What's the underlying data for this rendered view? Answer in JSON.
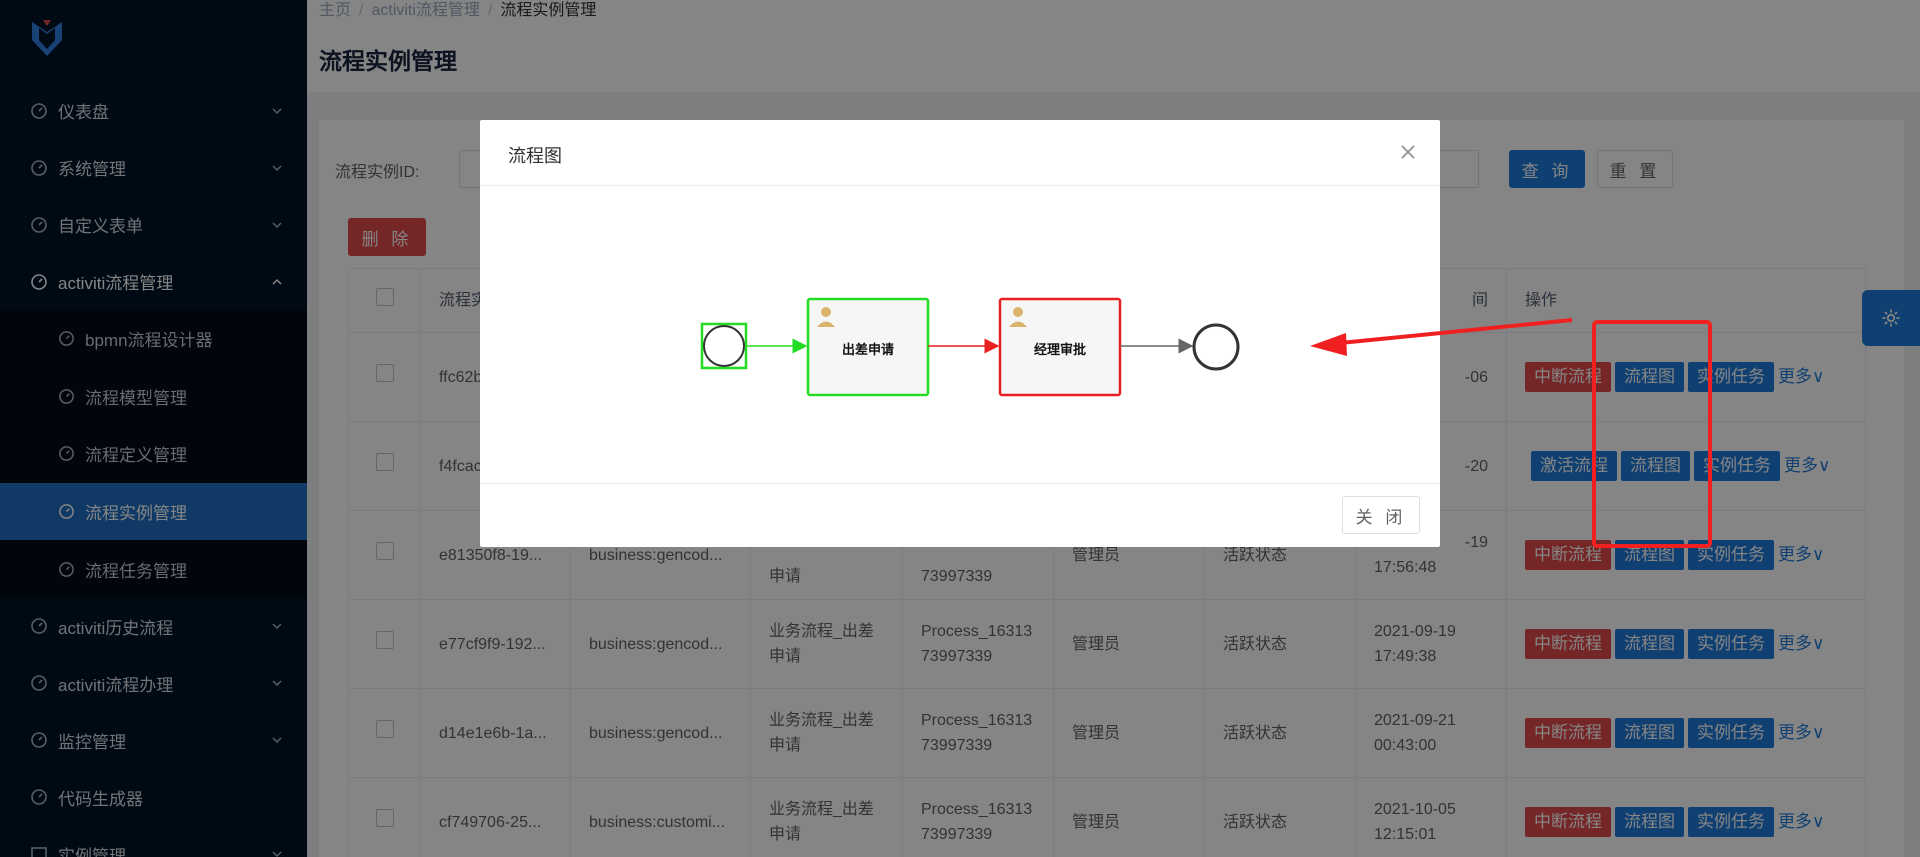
{
  "sidebar": {
    "menu": [
      {
        "label": "仪表盘"
      },
      {
        "label": "系统管理"
      },
      {
        "label": "自定义表单"
      },
      {
        "label": "activiti流程管理"
      }
    ],
    "submenu": [
      {
        "label": "bpmn流程设计器"
      },
      {
        "label": "流程模型管理"
      },
      {
        "label": "流程定义管理"
      },
      {
        "label": "流程实例管理"
      },
      {
        "label": "流程任务管理"
      }
    ],
    "menu_after": [
      {
        "label": "activiti历史流程"
      },
      {
        "label": "activiti流程办理"
      },
      {
        "label": "监控管理"
      },
      {
        "label": "代码生成器"
      },
      {
        "label": "实例管理"
      }
    ]
  },
  "breadcrumb": {
    "home": "主页",
    "sep": "/",
    "level1": "activiti流程管理",
    "current": "流程实例管理"
  },
  "page": {
    "title": "流程实例管理"
  },
  "search": {
    "label": "流程实例ID:",
    "query_label": "查 询",
    "reset_label": "重 置"
  },
  "toolbar": {
    "delete_label": "删 除"
  },
  "table": {
    "headers": {
      "id": "流程实",
      "op": "操作",
      "time": "间"
    },
    "rows": [
      {
        "id": "ffc62b",
        "key": "",
        "name": "",
        "def": "",
        "user": "",
        "state": "",
        "time": "-06",
        "first_op": "中断流程"
      },
      {
        "id": "f4fcac",
        "key": "",
        "name": "",
        "def": "",
        "user": "",
        "state": "",
        "time": "-20",
        "first_op": "激活流程"
      },
      {
        "id": "e81350f8-19...",
        "key": "business:gencod...",
        "name": "申请",
        "def": "73997339",
        "user": "管理员",
        "state": "活跃状态",
        "time1": "-19",
        "time2": "17:56:48",
        "first_op": "中断流程"
      },
      {
        "id": "e77cf9f9-192...",
        "key": "business:gencod...",
        "name1": "业务流程_出差",
        "name2": "申请",
        "def1": "Process_16313",
        "def2": "73997339",
        "user": "管理员",
        "state": "活跃状态",
        "time1": "2021-09-19",
        "time2": "17:49:38",
        "first_op": "中断流程"
      },
      {
        "id": "d14e1e6b-1a...",
        "key": "business:gencod...",
        "name1": "业务流程_出差",
        "name2": "申请",
        "def1": "Process_16313",
        "def2": "73997339",
        "user": "管理员",
        "state": "活跃状态",
        "time1": "2021-09-21",
        "time2": "00:43:00",
        "first_op": "中断流程"
      },
      {
        "id": "cf749706-25...",
        "key": "business:customi...",
        "name1": "业务流程_出差",
        "name2": "申请",
        "def1": "Process_16313",
        "def2": "73997339",
        "user": "管理员",
        "state": "活跃状态",
        "time1": "2021-10-05",
        "time2": "12:15:01",
        "first_op": "中断流程"
      }
    ],
    "ops": {
      "diagram": "流程图",
      "task": "实例任务",
      "more": "更多∨"
    }
  },
  "dialog": {
    "title": "流程图",
    "close_label": "关 闭",
    "nodes": {
      "task1": "出差申请",
      "task2": "经理审批"
    }
  },
  "colors": {
    "sidebar_bg": "#001529",
    "active": "#1f6fc1",
    "primary": "#1f7bd8",
    "danger": "#e04b4b",
    "bpmn_done": "#22dd22",
    "bpmn_current": "#e82020",
    "annotation": "#f02020"
  }
}
